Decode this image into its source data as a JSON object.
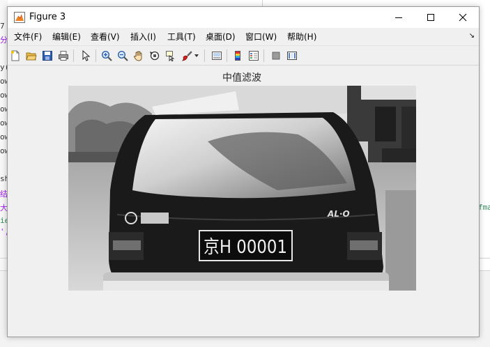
{
  "window": {
    "title": "Figure 3",
    "controls": [
      "minimize",
      "maximize",
      "close"
    ]
  },
  "menu": {
    "items": [
      {
        "label": "文件(F)"
      },
      {
        "label": "编辑(E)"
      },
      {
        "label": "查看(V)"
      },
      {
        "label": "插入(I)"
      },
      {
        "label": "工具(T)"
      },
      {
        "label": "桌面(D)"
      },
      {
        "label": "窗口(W)"
      },
      {
        "label": "帮助(H)"
      }
    ],
    "overflow_arrow": "↘"
  },
  "toolbar": {
    "buttons": [
      "new-figure-icon",
      "open-file-icon",
      "save-icon",
      "print-icon",
      "edit-plot-arrow-icon",
      "zoom-in-icon",
      "zoom-out-icon",
      "pan-hand-icon",
      "rotate-3d-icon",
      "data-cursor-icon",
      "brush-icon",
      "brush-dropdown-icon",
      "link-plot-icon",
      "insert-colorbar-icon",
      "insert-legend-icon",
      "hide-plot-tools-icon",
      "show-plot-tools-icon"
    ]
  },
  "axes": {
    "title": "中值滤波"
  },
  "image": {
    "plate_text": "京H 00001",
    "badge_text": "AL∙O"
  },
  "background": {
    "left_fragments": [
      "7",
      "分",
      "y(",
      "ow",
      "ow",
      "ow",
      "ow",
      "ow",
      "ow",
      "sh",
      "结",
      "大",
      "ie",
      "',"
    ],
    "right_fragment": "fma"
  }
}
